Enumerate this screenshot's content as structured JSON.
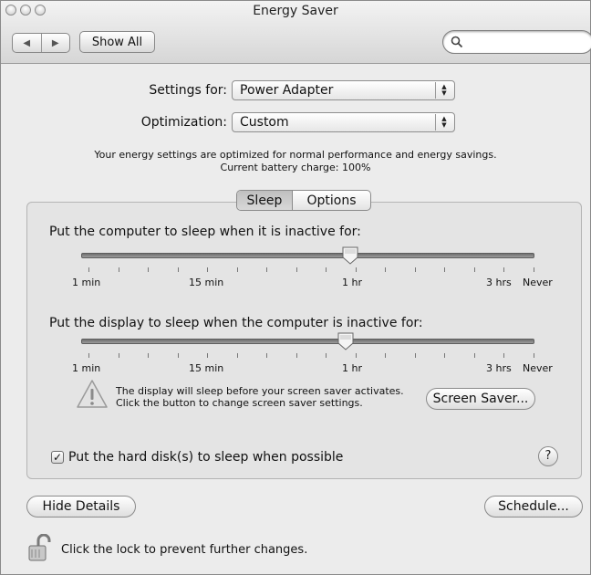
{
  "window": {
    "title": "Energy Saver"
  },
  "toolbar": {
    "back_icon": "left-arrow",
    "forward_icon": "right-arrow",
    "show_all_label": "Show All",
    "search_placeholder": "",
    "search_icon": "magnifier"
  },
  "settings": {
    "settings_for_label": "Settings for:",
    "settings_for_value": "Power Adapter",
    "optimization_label": "Optimization:",
    "optimization_value": "Custom",
    "info_line1": "Your energy settings are optimized for normal performance and energy savings.",
    "info_line2": "Current battery charge: 100%"
  },
  "tabs": [
    {
      "label": "Sleep",
      "selected": true
    },
    {
      "label": "Options",
      "selected": false
    }
  ],
  "sleep": {
    "computer_label": "Put the computer to sleep when it is inactive for:",
    "computer_value": "1 hr",
    "display_label": "Put the display to sleep when the computer is inactive for:",
    "display_value": "1 hr",
    "tick_labels": [
      "1 min",
      "15 min",
      "1 hr",
      "3 hrs",
      "Never"
    ],
    "warning_line1": "The display will sleep before your screen saver activates.",
    "warning_line2": "Click the button to change screen saver settings.",
    "screen_saver_button": "Screen Saver...",
    "disk_sleep_label": "Put the hard disk(s) to sleep when possible",
    "disk_sleep_checked": true,
    "help_label": "?"
  },
  "footer": {
    "hide_details_label": "Hide Details",
    "schedule_label": "Schedule...",
    "lock_text": "Click the lock to prevent further changes.",
    "lock_icon": "open-padlock"
  }
}
